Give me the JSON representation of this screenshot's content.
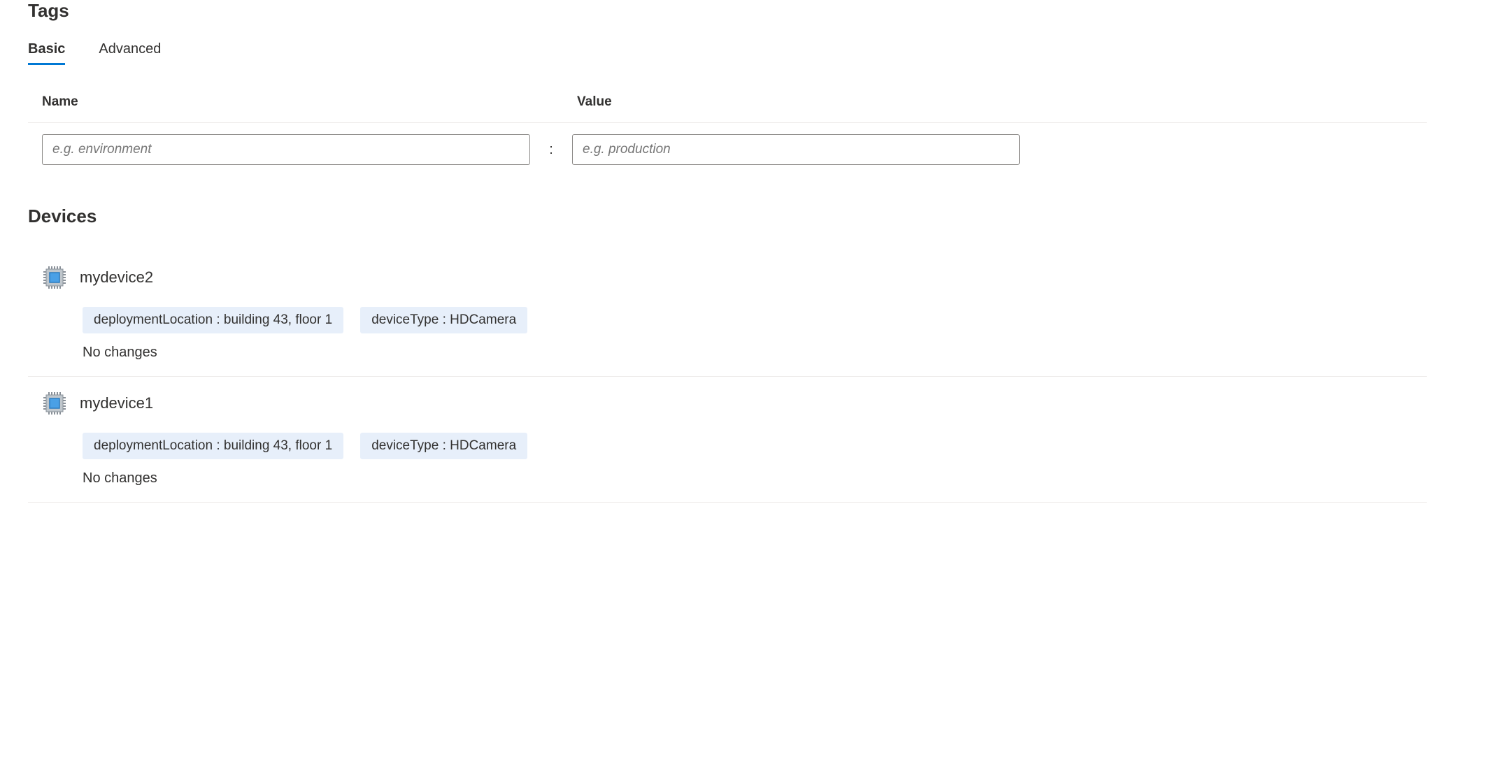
{
  "tags_section": {
    "title": "Tags",
    "tabs": {
      "basic": "Basic",
      "advanced": "Advanced"
    },
    "columns": {
      "name": "Name",
      "value": "Value"
    },
    "input": {
      "name_placeholder": "e.g. environment",
      "separator": ":",
      "value_placeholder": "e.g. production"
    }
  },
  "devices_section": {
    "title": "Devices",
    "devices": [
      {
        "name": "mydevice2",
        "tags": [
          "deploymentLocation : building 43, floor 1",
          "deviceType : HDCamera"
        ],
        "status": "No changes"
      },
      {
        "name": "mydevice1",
        "tags": [
          "deploymentLocation : building 43, floor 1",
          "deviceType : HDCamera"
        ],
        "status": "No changes"
      }
    ]
  }
}
